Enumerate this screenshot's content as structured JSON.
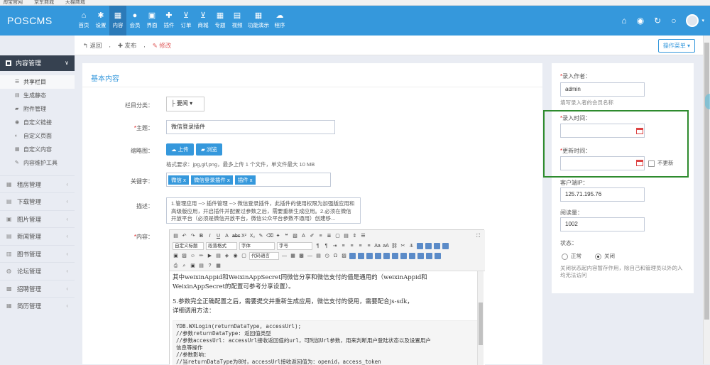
{
  "bookmarks": [
    "淘宝官网",
    "京东商城",
    "天猫商城"
  ],
  "app": {
    "title": "POSCMS"
  },
  "topnav": [
    {
      "label": "首页",
      "icon": "home-icon",
      "glyph": "⌂"
    },
    {
      "label": "设置",
      "icon": "gear-icon",
      "glyph": "✱"
    },
    {
      "label": "内容",
      "icon": "grid-icon",
      "glyph": "▦",
      "active": true
    },
    {
      "label": "会员",
      "icon": "user-icon",
      "glyph": "●"
    },
    {
      "label": "界面",
      "icon": "html5-icon",
      "glyph": "▣"
    },
    {
      "label": "插件",
      "icon": "puzzle-icon",
      "glyph": "✚"
    },
    {
      "label": "订单",
      "icon": "cart-icon",
      "glyph": "⊻"
    },
    {
      "label": "商城",
      "icon": "cart-icon",
      "glyph": "⊻"
    },
    {
      "label": "专题",
      "icon": "table-icon",
      "glyph": "▦"
    },
    {
      "label": "视频",
      "icon": "file-icon",
      "glyph": "▤"
    },
    {
      "label": "功能演示",
      "icon": "table-icon",
      "glyph": "▦"
    },
    {
      "label": "程序",
      "icon": "cloud-icon",
      "glyph": "☁"
    }
  ],
  "topright": [
    {
      "icon": "home-icon",
      "glyph": "⌂"
    },
    {
      "icon": "globe-icon",
      "glyph": "◉"
    },
    {
      "icon": "refresh-icon",
      "glyph": "↻"
    },
    {
      "icon": "power-icon",
      "glyph": "○"
    }
  ],
  "sidebar": {
    "header": "内容管理",
    "subitems": [
      {
        "label": "共享栏目",
        "glyph": "☰",
        "icon": "list-icon",
        "active": true
      },
      {
        "label": "生成静态",
        "glyph": "▤",
        "icon": "file-icon"
      },
      {
        "label": "附件管理",
        "glyph": "▰",
        "icon": "folder-icon"
      },
      {
        "label": "自定义链接",
        "glyph": "◉",
        "icon": "map-marker-icon"
      },
      {
        "label": "自定义页面",
        "glyph": "◐",
        "icon": "clock-icon"
      },
      {
        "label": "自定义内容",
        "glyph": "▦",
        "icon": "th-icon"
      },
      {
        "label": "内容维护工具",
        "glyph": "✎",
        "icon": "wrench-icon"
      }
    ],
    "menus": [
      {
        "label": "租房管理",
        "glyph": "▦",
        "icon": "table-icon"
      },
      {
        "label": "下载管理",
        "glyph": "▤",
        "icon": "download-icon"
      },
      {
        "label": "图片管理",
        "glyph": "▣",
        "icon": "picture-icon"
      },
      {
        "label": "新闻管理",
        "glyph": "▤",
        "icon": "news-icon"
      },
      {
        "label": "图书管理",
        "glyph": "▥",
        "icon": "book-icon"
      },
      {
        "label": "论坛管理",
        "glyph": "◍",
        "icon": "comments-icon"
      },
      {
        "label": "招聘管理",
        "glyph": "▩",
        "icon": "briefcase-icon"
      },
      {
        "label": "简历管理",
        "glyph": "▦",
        "icon": "th-icon"
      }
    ]
  },
  "toolbar": {
    "back": "返回",
    "publish": "发布",
    "edit": "修改",
    "op_menu": "操作菜单"
  },
  "form": {
    "section_title": "基本内容",
    "category_label": "栏目分类：",
    "category_value": "├ 要闻",
    "title_label": "主题：",
    "title_value": "微信登录插件",
    "thumb_label": "缩略图：",
    "upload_btn": "上传",
    "browse_btn": "浏览",
    "thumb_hint": "格式要求：jpg,gif,png，最多上传 1 个文件，单文件最大 10 MB",
    "keywords_label": "关键字：",
    "keywords": [
      "微信",
      "微信登录插件",
      "插件"
    ],
    "desc_label": "描述：",
    "desc_value": "1.管理应用 --> 插件管理 --> 微信登录插件，此插件的使用权限为加强版应用和高级版应用，开启插件并配置过参数之后，需要重新生成应用。2.必须在微信开放平台（必须是微信开放平台，微信公众平台参数不通用）创建移...",
    "content_label": "内容："
  },
  "editor": {
    "format_select": "自定义标题",
    "para_select": "段落格式",
    "font_select": "字体",
    "size_select": "字号",
    "code_select": "代码语言",
    "line1": "其中weixinAppid和WeixinAppSecret同微信分享和微信支付的值是通用的（weixinAppid和",
    "line2": "WeixinAppSecret的配置可参考分享设置）。",
    "line3": "5.参数完全正确配置之后，需要提交并重新生成应用，微信支付的使用，需要配合js-sdk，",
    "line4": "详细调用方法：",
    "code1": "YDB.WXLogin(returnDataType, accessUrl);",
    "code2": "    //参数returnDataType:  返回值类型",
    "code3": "    //参数accessUrl:  accessUrl接收返回值的url，可附加Url参数，用来判断用户登陆状态以及设置用户",
    "code4": "信息等操作",
    "code5": "    //参数影响：",
    "code6": "    //当returnDataType为0时，accessUrl接收返回值为：openid，access_token"
  },
  "right": {
    "author_label": "录入作者：",
    "author_value": "admin",
    "author_hint": "填写录入者的会员名称",
    "input_time_label": "录入时间：",
    "update_time_label": "更新时间：",
    "no_update": "不更新",
    "ip_label": "客户端IP：",
    "ip_value": "125.71.195.76",
    "views_label": "阅读量：",
    "views_value": "1002",
    "status_label": "状态：",
    "status_normal": "正常",
    "status_closed": "关闭",
    "status_hint": "关闭状态起内容暂存作用，除自己和管理员以外的人均无法访问"
  },
  "colors": {
    "brand": "#3598dc",
    "sidebar_head": "#364150",
    "highlight_box": "#2e8b2e"
  }
}
